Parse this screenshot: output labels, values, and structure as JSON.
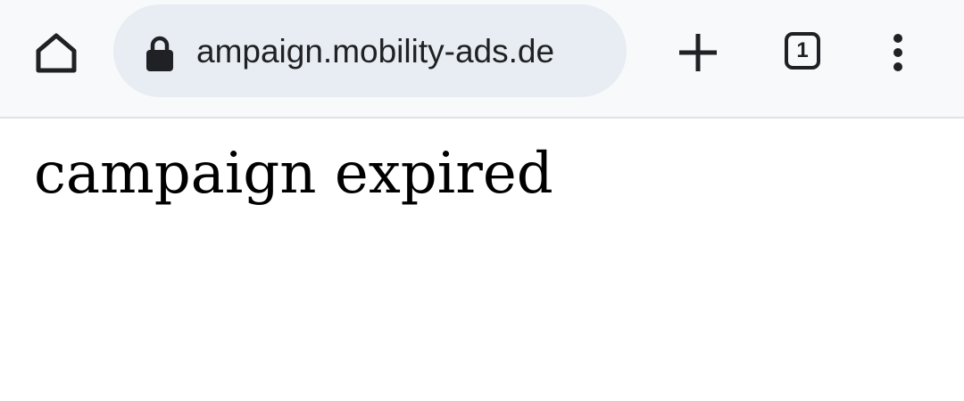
{
  "browser": {
    "url": "ampaign.mobility-ads.de",
    "tab_count": "1",
    "icons": {
      "home": "home-icon",
      "lock": "lock-icon",
      "new_tab": "plus-icon",
      "tabs": "tab-switcher-icon",
      "menu": "kebab-menu-icon"
    }
  },
  "page": {
    "heading": "campaign expired"
  },
  "colors": {
    "toolbar_bg": "#f8f9fb",
    "omnibox_bg": "#e7edf2",
    "icon": "#202124",
    "text": "#000000"
  }
}
